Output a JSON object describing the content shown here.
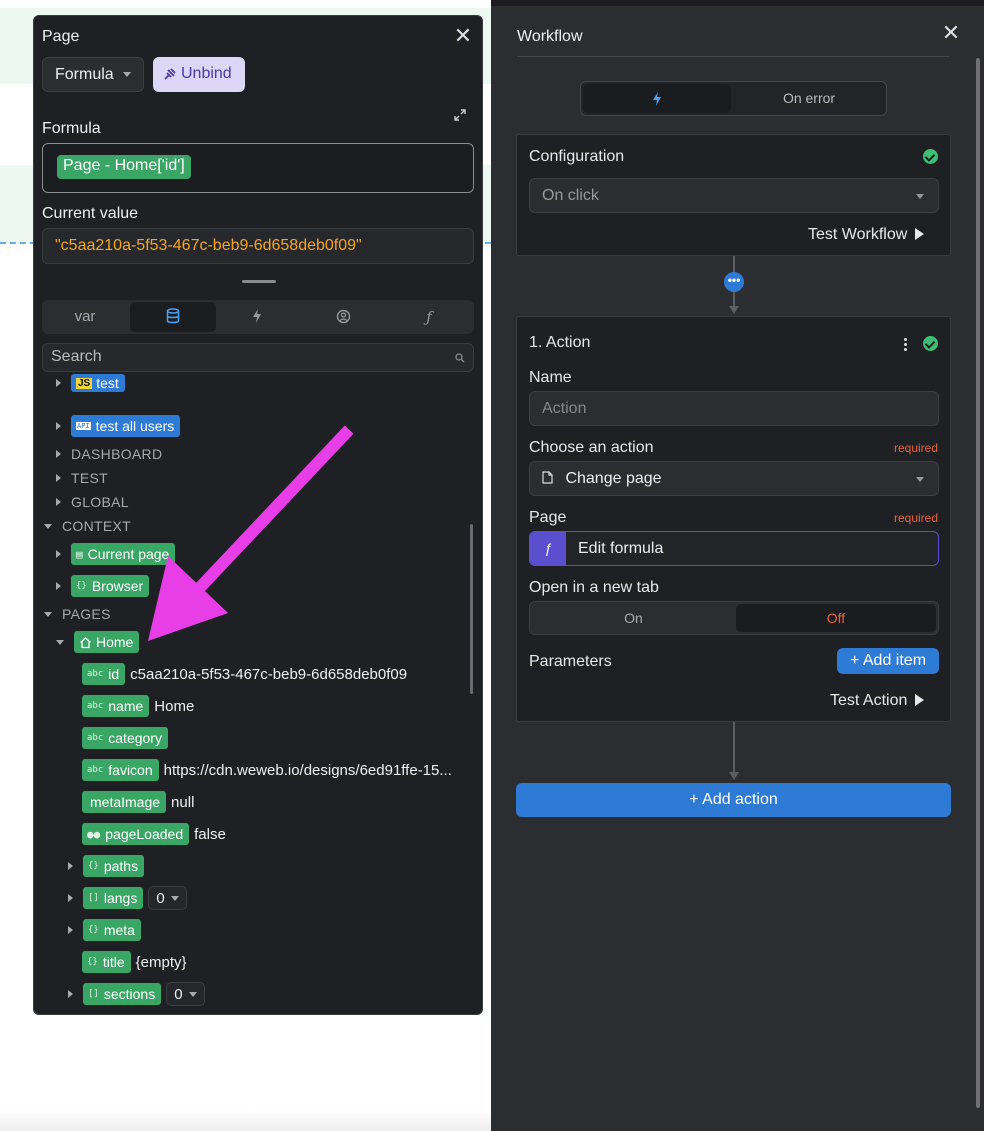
{
  "popup": {
    "title": "Page",
    "mode_label": "Formula",
    "unbind_label": "Unbind",
    "formula_label": "Formula",
    "formula_chip": "Page - Home['id']",
    "current_value_label": "Current value",
    "current_value": "\"c5aa210a-5f53-467c-beb9-6d658deb0f09\"",
    "tabs": {
      "var": "var"
    },
    "search_placeholder": "Search",
    "tree": {
      "partial_item": "test",
      "test_all_users": "test all users",
      "dashboard": "DASHBOARD",
      "test": "TEST",
      "global": "GLOBAL",
      "context": "CONTEXT",
      "current_page": "Current page",
      "browser": "Browser",
      "pages": "PAGES",
      "home": "Home",
      "props": [
        {
          "key": "id",
          "icon": "abc",
          "value": "c5aa210a-5f53-467c-beb9-6d658deb0f09"
        },
        {
          "key": "name",
          "icon": "abc",
          "value": "Home"
        },
        {
          "key": "category",
          "icon": "abc",
          "value": ""
        },
        {
          "key": "favicon",
          "icon": "abc",
          "value": "https://cdn.weweb.io/designs/6ed91ffe-15..."
        },
        {
          "key": "metaImage",
          "icon": "",
          "value": "null"
        },
        {
          "key": "pageLoaded",
          "icon": "bool",
          "value": "false"
        }
      ],
      "paths": "paths",
      "langs": "langs",
      "langs_count": "0",
      "meta": "meta",
      "title": "title",
      "title_value": "{empty}",
      "sections": "sections",
      "sections_count": "0"
    }
  },
  "workflow": {
    "title": "Workflow",
    "on_error_tab": "On error",
    "configuration": {
      "heading": "Configuration",
      "trigger": "On click",
      "test_label": "Test Workflow"
    },
    "action": {
      "heading": "1. Action",
      "name_label": "Name",
      "name_placeholder": "Action",
      "choose_label": "Choose an action",
      "required": "required",
      "choose_value": "Change page",
      "page_label": "Page",
      "page_required": "required",
      "page_formula": "Edit formula",
      "new_tab_label": "Open in a new tab",
      "on_label": "On",
      "off_label": "Off",
      "params_label": "Parameters",
      "add_item": "+ Add item",
      "test_label": "Test Action"
    },
    "add_action": "+ Add action"
  },
  "colors": {
    "accent_blue": "#2e7bd6",
    "green_chip": "#3aa666",
    "formula_purple": "#5b4fcf",
    "value_orange": "#f5a623",
    "required_red": "#e8643d",
    "arrow_magenta": "#e83ee8"
  },
  "icons": [
    "close-icon",
    "expand-icon",
    "bolt-icon",
    "database-icon",
    "user-circle-icon",
    "function-icon",
    "search-icon",
    "home-icon",
    "page-icon",
    "braces-icon",
    "brackets-icon",
    "more-vertical-icon",
    "check-circle-icon",
    "play-icon"
  ]
}
